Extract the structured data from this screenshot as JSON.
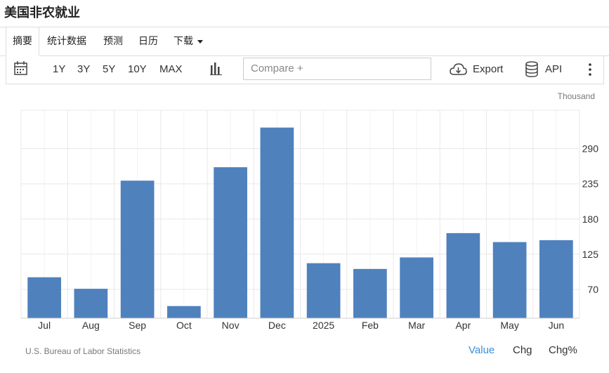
{
  "page_title": "美国非农就业",
  "tabs": [
    {
      "label": "摘要",
      "active": true
    },
    {
      "label": "统计数据"
    },
    {
      "label": "预测"
    },
    {
      "label": "日历"
    },
    {
      "label": "下载"
    }
  ],
  "toolbar": {
    "ranges": [
      "1Y",
      "3Y",
      "5Y",
      "10Y",
      "MAX"
    ],
    "compare_placeholder": "Compare +",
    "export_label": "Export",
    "api_label": "API"
  },
  "unit_label": "Thousand",
  "source_label": "U.S. Bureau of Labor Statistics",
  "view_buttons": [
    {
      "label": "Value",
      "active": true
    },
    {
      "label": "Chg"
    },
    {
      "label": "Chg%"
    }
  ],
  "colors": {
    "bar": "#4f81bd",
    "grid": "#e8e8e8",
    "active": "#3d8fd6"
  },
  "chart_data": {
    "type": "bar",
    "categories": [
      "Jul",
      "Aug",
      "Sep",
      "Oct",
      "Nov",
      "Dec",
      "2025",
      "Feb",
      "Mar",
      "Apr",
      "May",
      "Jun"
    ],
    "values": [
      89,
      71,
      240,
      44,
      261,
      323,
      111,
      102,
      120,
      158,
      144,
      147
    ],
    "yticks": [
      70,
      125,
      180,
      235,
      290
    ],
    "ylim": [
      25,
      350
    ],
    "ylabel": "Thousand",
    "grid": true
  }
}
